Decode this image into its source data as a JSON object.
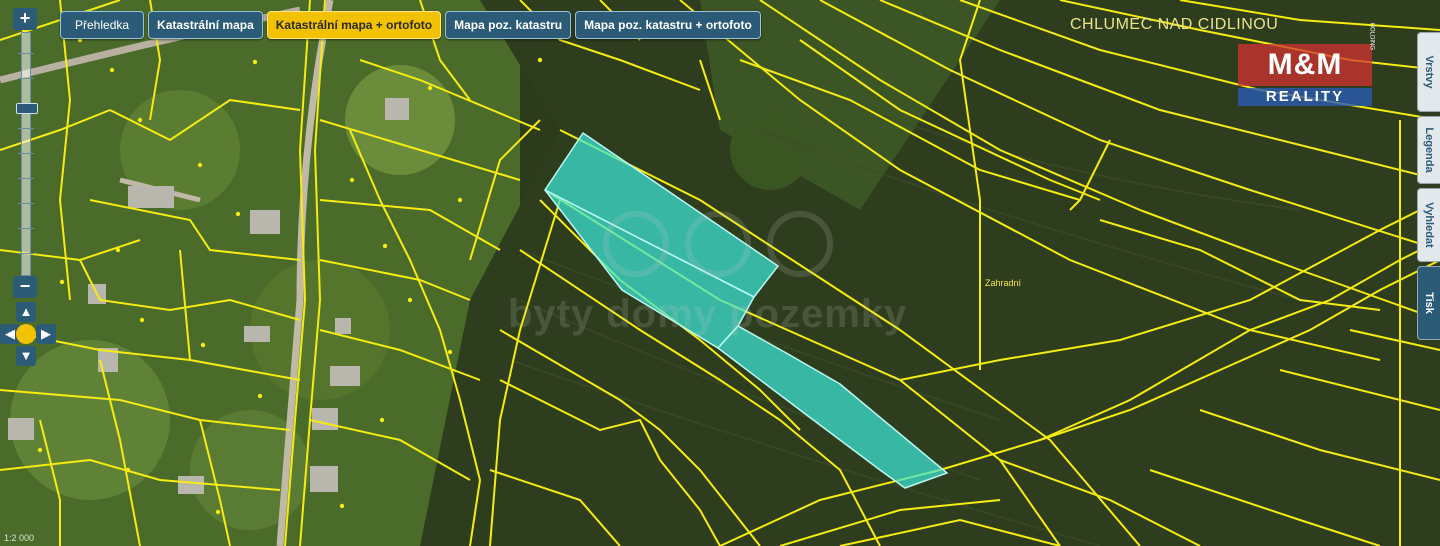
{
  "tabs": [
    {
      "label": "Přehledka",
      "active": false
    },
    {
      "label": "Katastrální mapa",
      "active": false
    },
    {
      "label": "Katastrální mapa + ortofoto",
      "active": true
    },
    {
      "label": "Mapa poz. katastru",
      "active": false
    },
    {
      "label": "Mapa poz. katastru + ortofoto",
      "active": false
    }
  ],
  "zoom": {
    "plus": "+",
    "minus": "−"
  },
  "pan": {
    "up": "▲",
    "down": "▼",
    "left": "◀",
    "right": "▶"
  },
  "side_tabs": [
    {
      "label": "Vrstvy",
      "active": false
    },
    {
      "label": "Legenda",
      "active": false
    },
    {
      "label": "Vyhledat",
      "active": false
    },
    {
      "label": "Tisk",
      "active": true
    }
  ],
  "place_name": "CHLUMEC NAD CIDLINOU",
  "logo": {
    "top": "M&M",
    "holding": "HOLDING",
    "bottom": "REALITY"
  },
  "watermark": "byty domy pozemky",
  "map_label": "Zahradní",
  "scale": "1:2 000",
  "colors": {
    "parcel_line": "#f5ec12",
    "highlight": "#3fe6da",
    "button": "#2c5b78",
    "active_button": "#f2c200"
  }
}
